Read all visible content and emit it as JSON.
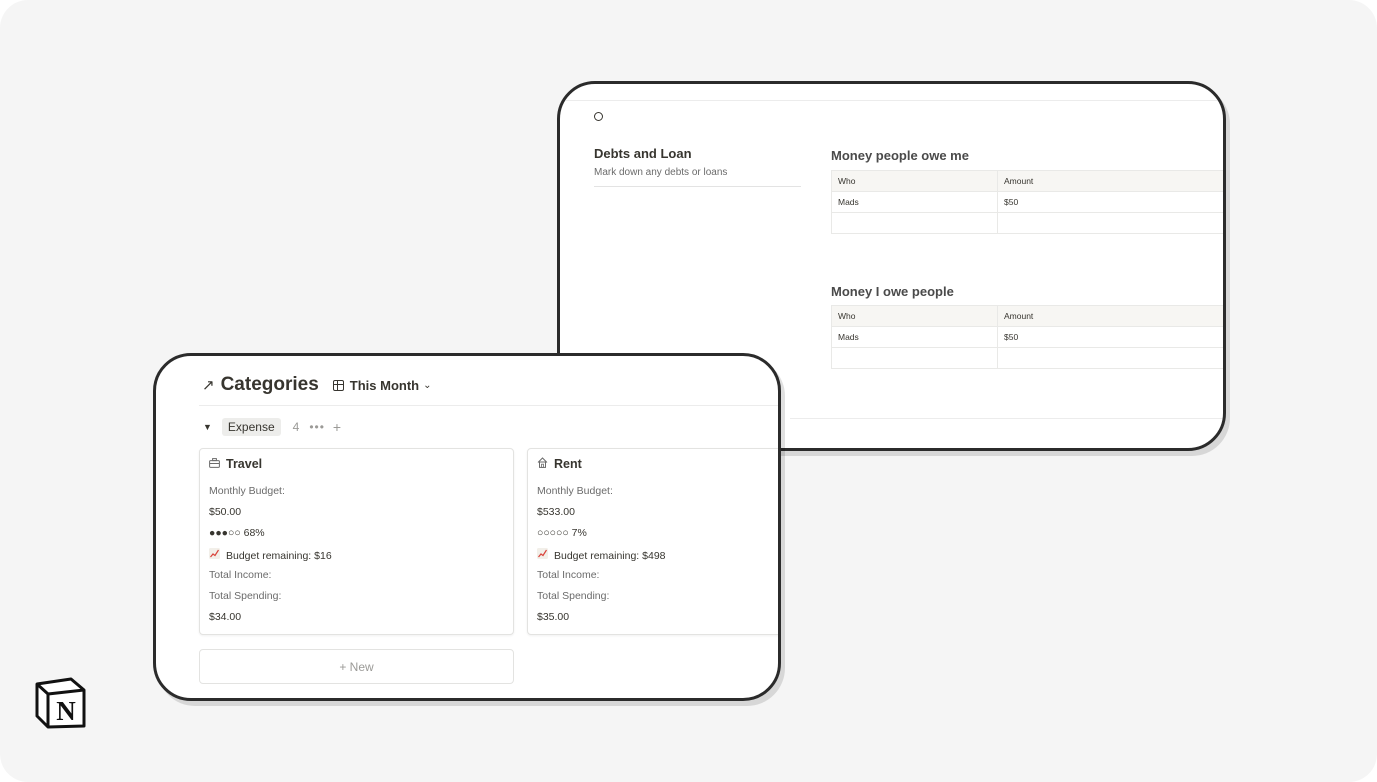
{
  "debts": {
    "title": "Debts and Loan",
    "description": "Mark down any debts or loans",
    "owed_to_me": {
      "title": "Money people owe me",
      "columns": [
        "Who",
        "Amount"
      ],
      "rows": [
        [
          "Mads",
          "$50"
        ]
      ]
    },
    "i_owe": {
      "title": "Money I owe people",
      "columns": [
        "Who",
        "Amount"
      ],
      "rows": [
        [
          "Mads",
          "$50"
        ]
      ]
    }
  },
  "categories": {
    "title": "Categories",
    "view_label": "This Month",
    "group": {
      "label": "Expense",
      "count": "4",
      "more": "•••",
      "add": "+"
    },
    "cards": [
      {
        "icon": "suitcase-icon",
        "title": "Travel",
        "budget_label": "Monthly Budget:",
        "budget_value": "$50.00",
        "progress": "●●●○○ 68%",
        "remaining": "Budget remaining: $16",
        "income_label": "Total Income:",
        "spending_label": "Total Spending:",
        "spending_value": "$34.00"
      },
      {
        "icon": "house-icon",
        "title": "Rent",
        "budget_label": "Monthly Budget:",
        "budget_value": "$533.00",
        "progress": "○○○○○ 7%",
        "remaining": "Budget remaining: $498",
        "income_label": "Total Income:",
        "spending_label": "Total Spending:",
        "spending_value": "$35.00"
      }
    ],
    "new_label": "+ New"
  },
  "logo": {
    "letter": "N",
    "name": "notion-logo"
  }
}
